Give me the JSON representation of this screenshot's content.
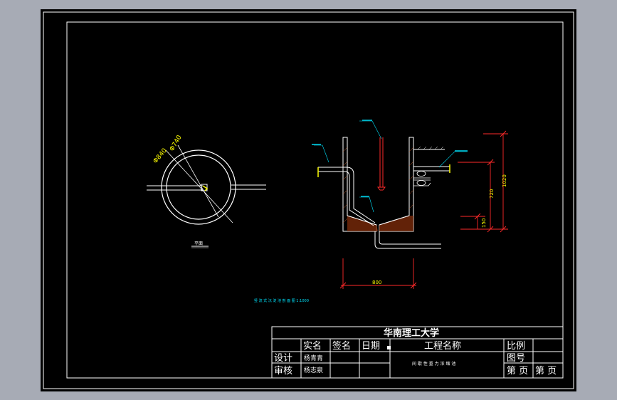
{
  "drawing": {
    "plan_view": {
      "label_outer": "Φ840",
      "label_inner": "Φ740",
      "caption": "平面"
    },
    "section_view": {
      "dims_vertical": [
        "1020",
        "720",
        "150"
      ],
      "dim_horizontal": "800"
    },
    "scale_note": "竖 流 式 沉 淀 池 剖 面 图   1:1000"
  },
  "title_block": {
    "school": "华南理工大学",
    "col_real_name": "实名",
    "col_signature": "签名",
    "col_date": "日期",
    "project_name_label": "工程名称",
    "scale_label": "比例",
    "drawing_no_label": "图号",
    "row_design": "设计",
    "row_review": "审核",
    "designer": "杨青青",
    "reviewer": "杨志泉",
    "project_name": "间 歇 性 重 力 浓 缩 池",
    "page_label_1": "第 页",
    "page_label_2": "第 页"
  },
  "colors": {
    "line": "#ffffff",
    "dimension": "#ff2a2a",
    "annotation": "#00e5ff",
    "highlight": "#ffff00",
    "background": "#000000"
  }
}
